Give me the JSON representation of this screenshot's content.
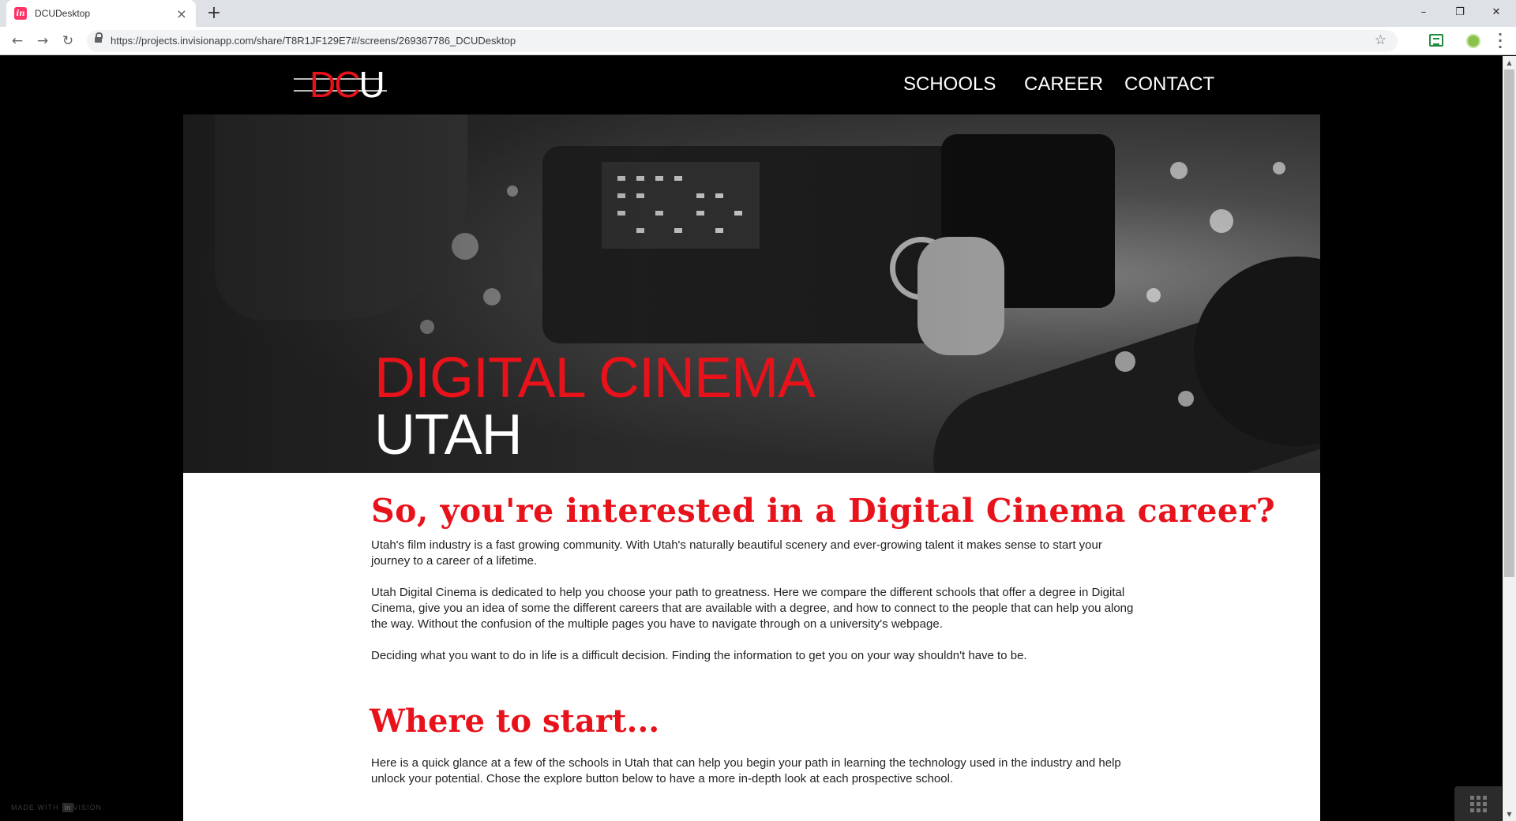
{
  "browser": {
    "tab_title": "DCUDesktop",
    "tab_favicon": "in",
    "tab_close": "×",
    "new_tab": "+",
    "url": "https://projects.invisionapp.com/share/T8R1JF129E7#/screens/269367786_DCUDesktop",
    "icons": [
      "back-arrow-icon",
      "forward-arrow-icon",
      "reload-icon",
      "lock-icon",
      "bookmark-star-icon",
      "extension-icon",
      "profile-icon",
      "menu-icon"
    ]
  },
  "site": {
    "logo": {
      "d": "D",
      "c": "C",
      "u": "U"
    },
    "nav": [
      "SCHOOLS",
      "CAREER",
      "CONTACT"
    ],
    "hero": {
      "line1": "DIGITAL CINEMA",
      "line2": "UTAH"
    },
    "section1": {
      "heading": "So, you're interested in a Digital Cinema career?",
      "paragraphs": [
        "Utah's film industry is a fast growing community. With Utah's naturally beautiful scenery and ever-growing talent it makes sense to start your journey to a career of a lifetime.",
        "Utah Digital Cinema is dedicated to help you choose your path to greatness. Here we compare the different schools that offer a degree in Digital Cinema, give you an idea of some the different careers that are available with a degree, and how to connect to the people that can help you along the way. Without the confusion of the multiple pages you have to navigate through on a university's webpage.",
        "Deciding what you want to do in life is a difficult decision. Finding the information to get you on your way shouldn't have to be."
      ]
    },
    "section2": {
      "heading": "Where to start...",
      "paragraph": "Here is a quick glance at a few of the schools in Utah that can help you begin your path in learning the technology used in the industry and help unlock your potential. Chose the explore button below to have a more in-depth look at each prospective school."
    }
  },
  "overlay": {
    "made_with": "MADE WITH",
    "made_with_brand": "in",
    "made_with_suffix": "VISION"
  },
  "colors": {
    "accent": "#e8121b",
    "page_bg": "#000000",
    "content_bg": "#ffffff"
  }
}
